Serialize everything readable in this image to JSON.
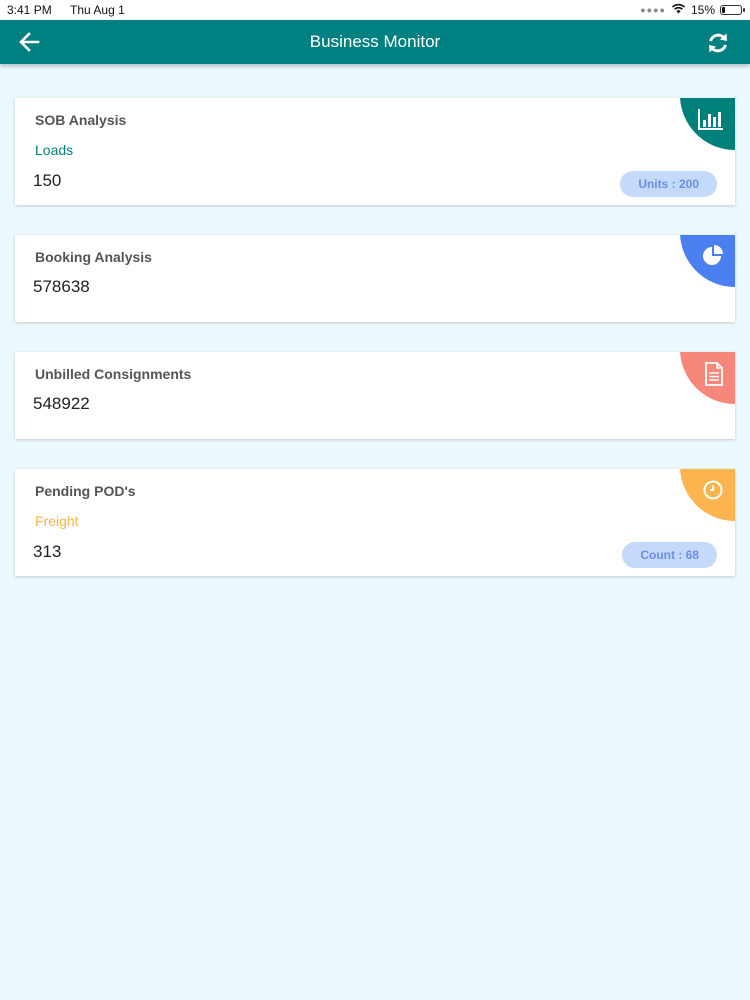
{
  "status_bar": {
    "time": "3:41 PM",
    "date": "Thu Aug 1",
    "battery": "15%",
    "battery_level": 0.15
  },
  "header": {
    "title": "Business Monitor",
    "back_icon": "back-arrow-icon",
    "refresh_icon": "refresh-icon"
  },
  "colors": {
    "app_bar": "#008080",
    "background": "#ebf9fc",
    "teal": "#00807a",
    "blue": "#4a7ff0",
    "salmon": "#f8877b",
    "orange": "#fbb44e"
  },
  "cards": [
    {
      "title": "SOB Analysis",
      "subtitle": "Loads",
      "value": "150",
      "badge": "Units : 200",
      "icon": "bar-chart-icon",
      "color": "#00807a"
    },
    {
      "title": "Booking Analysis",
      "value": "578638",
      "icon": "pie-chart-icon",
      "color": "#4a7ff0"
    },
    {
      "title": "Unbilled Consignments",
      "value": "548922",
      "icon": "document-icon",
      "color": "#f8877b"
    },
    {
      "title": "Pending POD's",
      "subtitle": "Freight",
      "value": "313",
      "badge": "Count : 68",
      "icon": "clock-icon",
      "color": "#fbb44e"
    }
  ]
}
